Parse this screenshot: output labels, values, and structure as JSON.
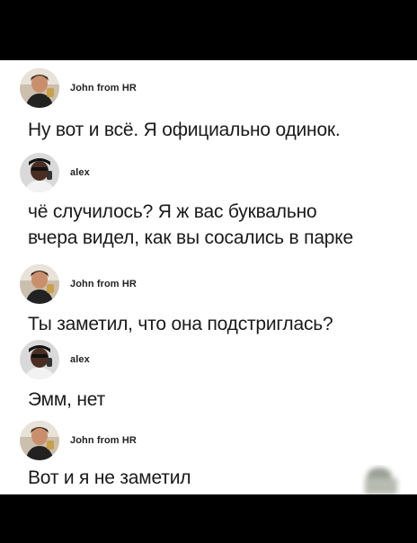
{
  "posts": [
    {
      "user": "John from HR",
      "avatar_icon": "john-avatar-icon",
      "lines": [
        "Ну вот и всё. Я официально одинок."
      ]
    },
    {
      "user": "alex",
      "avatar_icon": "alex-avatar-icon",
      "lines": [
        "чё случилось? Я ж вас буквально",
        "вчера видел, как вы сосались в парке"
      ]
    },
    {
      "user": "John from HR",
      "avatar_icon": "john-avatar-icon",
      "lines": [
        "Ты заметил, что она подстриглась?"
      ]
    },
    {
      "user": "alex",
      "avatar_icon": "alex-avatar-icon",
      "lines": [
        "Эмм, нет"
      ]
    },
    {
      "user": "John from HR",
      "avatar_icon": "john-avatar-icon",
      "lines": [
        "Вот и я не заметил"
      ]
    }
  ],
  "colors": {
    "background": "#000000",
    "panel": "#ffffff",
    "text": "#1a1a1a"
  }
}
